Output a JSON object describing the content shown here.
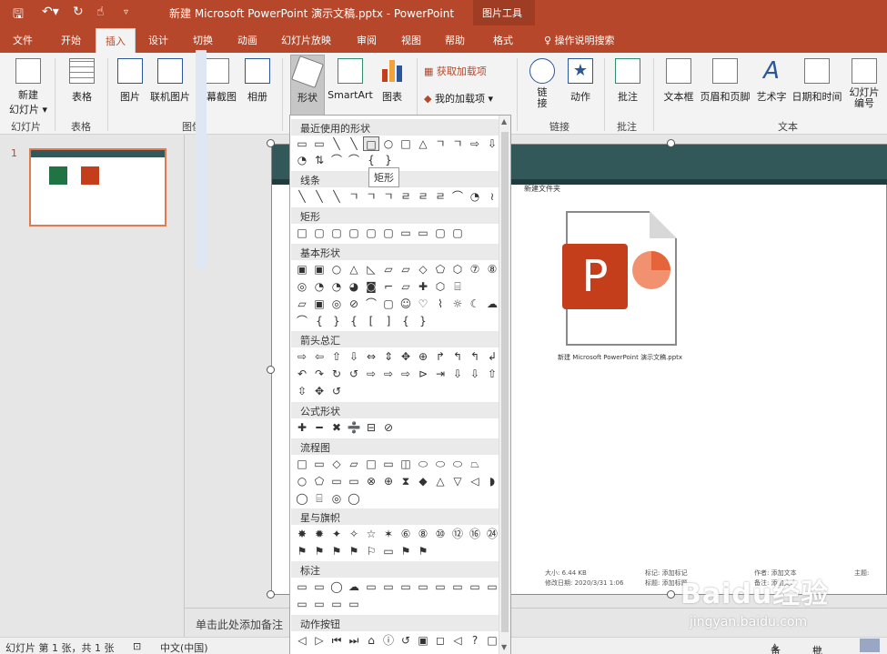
{
  "colors": {
    "accent": "#b7472a",
    "ppt_red": "#c43e1c"
  },
  "titlebar": {
    "title": "新建 Microsoft PowerPoint 演示文稿.pptx  -  PowerPoint",
    "picture_tools": "图片工具"
  },
  "tabs": [
    "文件",
    "开始",
    "插入",
    "设计",
    "切换",
    "动画",
    "幻灯片放映",
    "审阅",
    "视图",
    "帮助",
    "格式"
  ],
  "active_tab": "插入",
  "tell_me": "操作说明搜索",
  "ribbon": {
    "new_slide": "新建\n幻灯片 ▾",
    "table": "表格",
    "picture": "图片",
    "online_picture": "联机图片",
    "screenshot": "屏幕截图",
    "album": "相册",
    "shapes": "形状",
    "smartart": "SmartArt",
    "chart": "图表",
    "get_addins": "获取加载项",
    "my_addins": "我的加载项",
    "link": "链\n接",
    "action": "动作",
    "comment": "批注",
    "textbox": "文本框",
    "header_footer": "页眉和页脚",
    "wordart": "艺术字",
    "datetime": "日期和时间",
    "slide_number": "幻灯片\n编号",
    "groups": {
      "slides": "幻灯片",
      "tables": "表格",
      "images": "图像",
      "links": "链接",
      "comments": "批注",
      "text": "文本"
    }
  },
  "thumbnail_number": "1",
  "slide": {
    "explorer_title": "新建文件夹",
    "filename": "新建 Microsoft PowerPoint 演示文稿.pptx",
    "meta": [
      "大小: 6.44 KB",
      "修改日期: 2020/3/31 1:06",
      "标记: 添加标记",
      "标题: 添加标题",
      "作者: 添加文本",
      "备注: 添加文本",
      "主题:"
    ]
  },
  "notes_placeholder": "单击此处添加备注",
  "status": {
    "slide_info": "幻灯片 第 1 张，共 1 张",
    "language": "中文(中国)",
    "notes": "备注",
    "comments": "批注"
  },
  "watermark": {
    "main": "Baidu经验",
    "sub": "jingyan.baidu.com"
  },
  "tooltip": "矩形",
  "gallery": {
    "sections": [
      "最近使用的形状",
      "线条",
      "矩形",
      "基本形状",
      "箭头总汇",
      "公式形状",
      "流程图",
      "星与旗帜",
      "标注",
      "动作按钮"
    ],
    "rows": {
      "recent": [
        "▭",
        "▭",
        "╲",
        "╲",
        "□",
        "○",
        "□",
        "△",
        "ㄱ",
        "ㄱ",
        "⇨",
        "⇩"
      ],
      "recent2": [
        "◔",
        "⇅",
        "⌒",
        "⌒",
        "{",
        "}"
      ],
      "lines": [
        "╲",
        "╲",
        "╲",
        "ㄱ",
        "ㄱ",
        "ㄱ",
        "ㄹ",
        "ㄹ",
        "ㄹ",
        "⌒",
        "◔",
        "≀"
      ],
      "rect": [
        "□",
        "▢",
        "▢",
        "▢",
        "▢",
        "▢",
        "▭",
        "▭",
        "▢",
        "▢"
      ],
      "basic1": [
        "▣",
        "▣",
        "○",
        "△",
        "◺",
        "▱",
        "▱",
        "◇",
        "⬠",
        "⬡",
        "⑦",
        "⑧"
      ],
      "basic2": [
        "◎",
        "◔",
        "◔",
        "◕",
        "◙",
        "⌐",
        "▱",
        "✚",
        "⬡",
        "⌸"
      ],
      "basic3": [
        "▱",
        "▣",
        "◎",
        "⊘",
        "⌒",
        "▢",
        "☺",
        "♡",
        "⌇",
        "☼",
        "☾",
        "☁"
      ],
      "basic4": [
        "⌒",
        "{",
        "}",
        "{",
        "[",
        "]",
        "{",
        "}"
      ],
      "arrows1": [
        "⇨",
        "⇦",
        "⇧",
        "⇩",
        "⇔",
        "⇕",
        "✥",
        "⊕",
        "↱",
        "↰",
        "↰",
        "↲"
      ],
      "arrows2": [
        "↶",
        "↷",
        "↻",
        "↺",
        "⇨",
        "⇨",
        "⇨",
        "⊳",
        "⇥",
        "⇩",
        "⇩",
        "⇧"
      ],
      "arrows3": [
        "⇳",
        "✥",
        "↺"
      ],
      "equation": [
        "✚",
        "━",
        "✖",
        "➗",
        "⊟",
        "⊘"
      ],
      "flow1": [
        "□",
        "▭",
        "◇",
        "▱",
        "□",
        "▭",
        "◫",
        "⬭",
        "⬭",
        "⬭",
        "⏢"
      ],
      "flow2": [
        "○",
        "⬠",
        "▭",
        "▭",
        "⊗",
        "⊕",
        "⧗",
        "◆",
        "△",
        "▽",
        "◁",
        "◗"
      ],
      "flow3": [
        "◯",
        "⌸",
        "◎",
        "◯"
      ],
      "stars1": [
        "✸",
        "✹",
        "✦",
        "✧",
        "☆",
        "✶",
        "⑥",
        "⑧",
        "⑩",
        "⑫",
        "⑯",
        "㉔"
      ],
      "stars2": [
        "⚑",
        "⚑",
        "⚑",
        "⚑",
        "⚐",
        "▭",
        "⚑",
        "⚑"
      ],
      "callouts1": [
        "▭",
        "▭",
        "◯",
        "☁",
        "▭",
        "▭",
        "▭",
        "▭",
        "▭",
        "▭",
        "▭",
        "▭"
      ],
      "callouts2": [
        "▭",
        "▭",
        "▭",
        "▭"
      ],
      "action": [
        "◁",
        "▷",
        "⏮",
        "⏭",
        "⌂",
        "ⓘ",
        "↺",
        "▣",
        "◻",
        "◁",
        "?",
        "□"
      ]
    }
  }
}
